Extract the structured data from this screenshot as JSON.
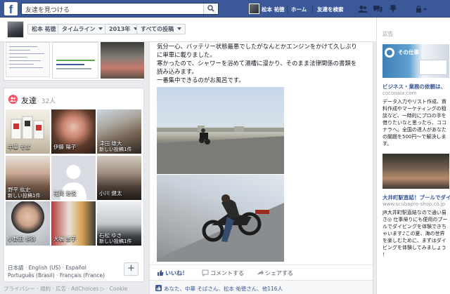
{
  "topbar": {
    "logo": "f",
    "search_placeholder": "友達を見つける",
    "user_name": "松本 祐徳",
    "home": "ホーム",
    "find_friends": "友達を検索"
  },
  "timeline_nav": {
    "name": "松本 祐徳",
    "timeline": "タイムライン",
    "year": "2013年",
    "all_posts": "すべての投稿"
  },
  "friends": {
    "title": "友達",
    "count": "· 32人",
    "tiles": [
      {
        "name": "中華 そば",
        "sub": ""
      },
      {
        "name": "伊藤 陽子",
        "sub": ""
      },
      {
        "name": "津田 雄大",
        "sub": "新しい投稿1件"
      },
      {
        "name": "野平 紘史",
        "sub": "新しい投稿1件"
      },
      {
        "name": "花岡 治悦",
        "sub": ""
      },
      {
        "name": "小川 健太",
        "sub": ""
      },
      {
        "name": "小野田 恒弥",
        "sub": ""
      },
      {
        "name": "大橋 恵子",
        "sub": ""
      },
      {
        "name": "石松 ゆき",
        "sub": "新しい投稿1件"
      }
    ],
    "lang_line1": "日本語 · English (US) · Español",
    "lang_line2": "Português (Brasil) · Français (France)",
    "add_label": "+"
  },
  "footer": "プライバシー · 規約 · 広告 · AdChoices ▷ · Cookie",
  "post": {
    "lines": [
      "気分一心、バッテリー状態最悪でしたがなんとかエンジンをかけて久しぶり",
      "に単車に載りました。",
      "寒かったので、シャワーを浴めて湯槽に漫かり、そのまま法律関係の書類を",
      "読み込みます。",
      "一番集中できるのがお風呂です。"
    ],
    "like": "いいね！",
    "comment": "コメントする",
    "share": "シェアする",
    "likes_text": "あなた、中華 そばさん、松本 祐徳さん、他116人"
  },
  "ads": {
    "title": "広告",
    "ad1": {
      "image_text": "その仕事",
      "title": "ビジネス・業務の依頼は、",
      "url": "coconala.com",
      "body": [
        "データ入力やリスト作成、資",
        "料作成やマーケティングの相",
        "談など、一時的にプロの手を",
        "借りたいなと思ったら、ココ",
        "ナラへ。全国の達人があなた",
        "の閣題を500円〜で解決しま",
        "す。"
      ]
    },
    "ad2": {
      "title": "大井町駅直結！プールでダイ…",
      "url": "www.scubapro-shop.co.jp",
      "body": [
        "JR大井町駅直結なので通い易",
        "さ◎ 仕事帰りにも便用のプー",
        "ルでダイビングを体験できち",
        "ゃいます♪この夏、海の世界",
        "を楽しむために、まずはダイ",
        "ビングを体験してみましょう",
        "！"
      ]
    }
  }
}
